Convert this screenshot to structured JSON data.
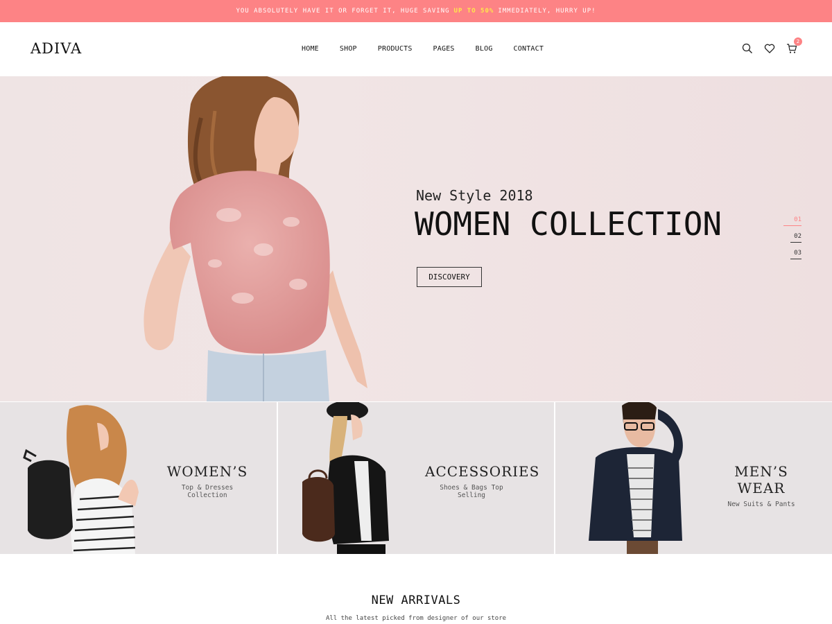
{
  "promo": {
    "before": "YOU ABSOLUTELY HAVE IT OR FORGET IT, HUGE SAVING",
    "highlight": "UP TO 50%",
    "after": "IMMEDIATELY, HURRY UP!",
    "highlight_color": "#ffe94a",
    "background_color": "#fd8385"
  },
  "header": {
    "logo": "ADIVA",
    "nav": [
      "HOME",
      "SHOP",
      "PRODUCTS",
      "PAGES",
      "BLOG",
      "CONTACT"
    ],
    "icons": [
      "search-icon",
      "heart-icon",
      "cart-icon"
    ],
    "cart_count": "2"
  },
  "hero": {
    "subtitle": "New Style 2018",
    "title": "WOMEN COLLECTION",
    "button_label": "DISCOVERY",
    "slides": [
      "01",
      "02",
      "03"
    ],
    "active_slide": "01",
    "accent_color": "#fd8385"
  },
  "categories": [
    {
      "title": "WOMEN’S",
      "subtitle": "Top & Dresses Collection"
    },
    {
      "title": "ACCESSORIES",
      "subtitle": "Shoes & Bags Top Selling"
    },
    {
      "title": "MEN’S WEAR",
      "subtitle": "New Suits & Pants"
    }
  ],
  "arrivals": {
    "title": "NEW ARRIVALS",
    "subtitle": "All the latest picked from designer of our store"
  }
}
